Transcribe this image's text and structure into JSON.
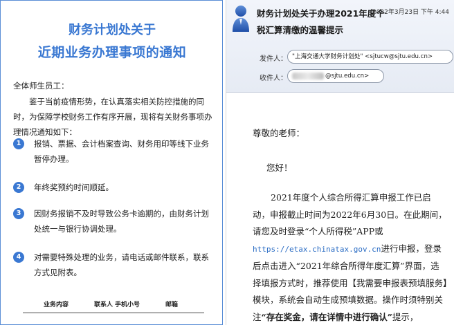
{
  "left_notice": {
    "title_line1": "财务计划处关于",
    "title_line2": "近期业务办理事项的通知",
    "greeting": "全体师生员工：",
    "intro": "鉴于当前疫情形势，在认真落实相关防控措施的同时，为保障学校财务工作有序开展，现将有关财务事项办理情况通知如下：",
    "items": [
      {
        "num": "1",
        "text": "报销、票据、会计档案查询、财务用印等线下业务暂停办理。"
      },
      {
        "num": "2",
        "text": "年终奖预约时间顺延。"
      },
      {
        "num": "3",
        "text": "因财务报销不及时导致公务卡逾期的，由财务计划处统一与银行协调处理。"
      },
      {
        "num": "4",
        "text": "对需要特殊处理的业务，请电话或邮件联系，联系方式见附表。"
      }
    ],
    "table_headers": [
      "业务内容",
      "联系人",
      "手机小号",
      "邮箱"
    ],
    "accent_color": "#3a78d2"
  },
  "email": {
    "subject": "财务计划处关于办理2021年度个税汇算清缴的温馨提示",
    "date": "2022年3月23日 下午 4:44",
    "from_label": "发件人：",
    "from_value": "\"上海交通大学财务计划处\" <sjtucw@sjtu.edu.cn>",
    "to_label": "收件人：",
    "to_value": "@sjtu.edu.cn>",
    "avatar_icon": "person-icon",
    "body": {
      "salutation": "尊敬的老师：",
      "hello": "您好！",
      "para_part1": "2021年度个人综合所得汇算申报工作已启动，申报截止时间为2022年6月30日。在此期间，请您及时登录“个人所得税”APP或",
      "link": "https://etax.chinatax.gov.cn",
      "para_part2": "进行申报，登录后点击进入“2021年综合所得年度汇算”界面，选择填报方式时，推荐使用【我需要申报表预填服务】模块，系统会自动生成预填数据。操作时须特别关注",
      "para_bold": "“存在奖金，请在详情中进行确认”",
      "para_part3": "提示，"
    }
  }
}
